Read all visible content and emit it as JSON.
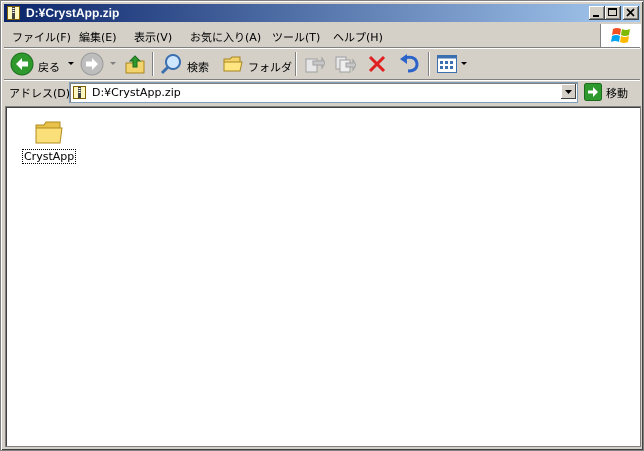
{
  "window": {
    "title": "D:¥CrystApp.zip"
  },
  "menu": [
    {
      "label": "ファイル(F)"
    },
    {
      "label": "編集(E)"
    },
    {
      "label": "表示(V)"
    },
    {
      "label": "お気に入り(A)"
    },
    {
      "label": "ツール(T)"
    },
    {
      "label": "ヘルプ(H)"
    }
  ],
  "toolbar": {
    "back_label": "戻る",
    "search_label": "検索",
    "folders_label": "フォルダ"
  },
  "address": {
    "label": "アドレス(D)",
    "value": "D:¥CrystApp.zip",
    "go_label": "移動"
  },
  "files": [
    {
      "name": "CrystApp",
      "icon": "folder-icon"
    }
  ],
  "colors": {
    "titlebar_start": "#0a246a",
    "titlebar_end": "#a6caf0",
    "chrome": "#d4d0c8"
  }
}
